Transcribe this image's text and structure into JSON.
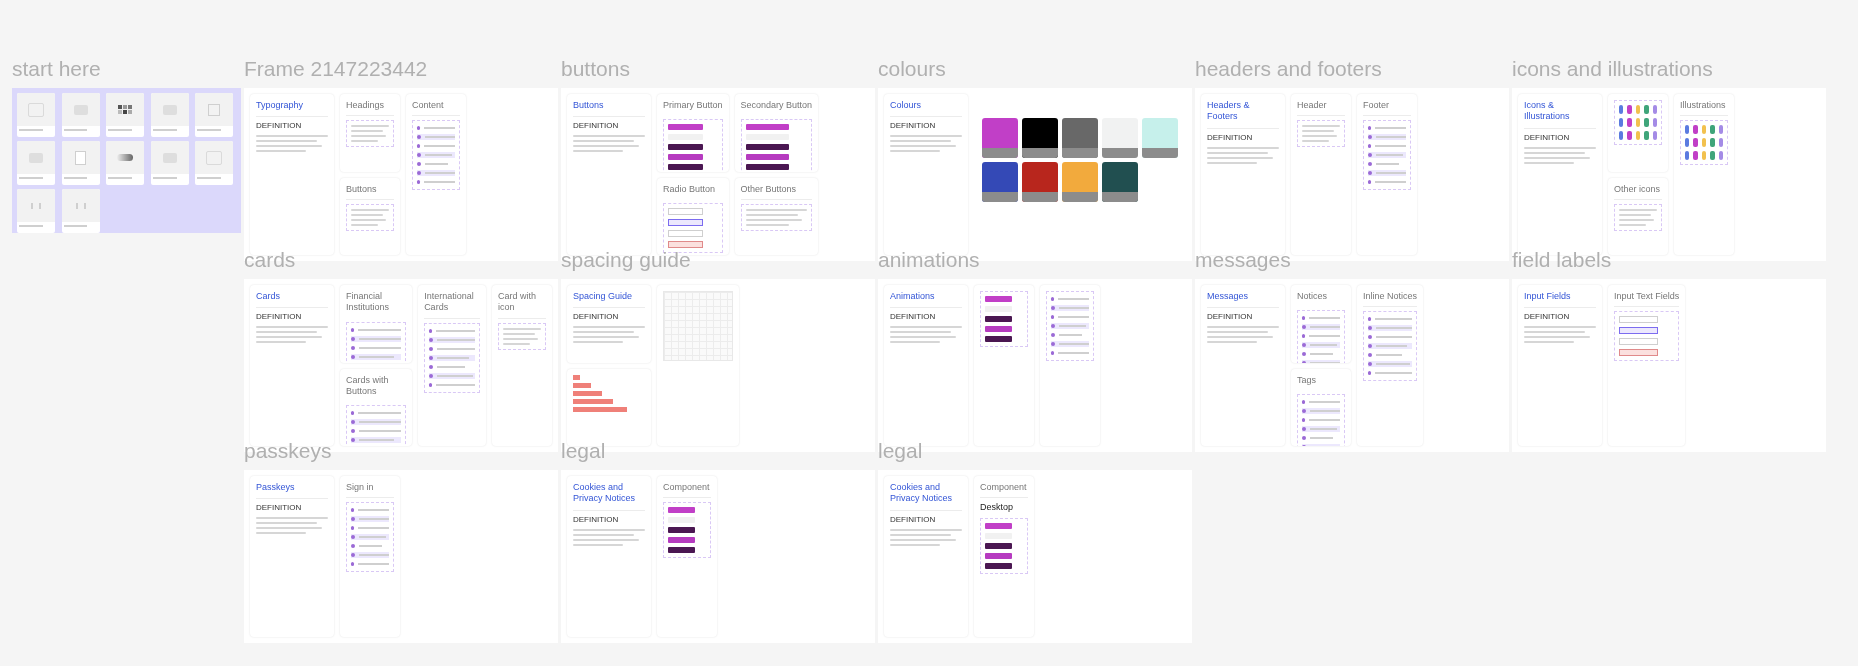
{
  "sections": [
    {
      "label": "start here",
      "kind": "thumbnails",
      "tiles": [
        {
          "kind": "type"
        },
        {
          "kind": "image"
        },
        {
          "kind": "swatch"
        },
        {
          "kind": "image"
        },
        {
          "kind": "frame"
        },
        {
          "kind": "image"
        },
        {
          "kind": "card"
        },
        {
          "kind": "motion"
        },
        {
          "kind": "image"
        },
        {
          "kind": "type"
        },
        {
          "kind": "code"
        },
        {
          "kind": "code"
        }
      ]
    },
    {
      "label": "Frame 2147223442",
      "kind": "frame",
      "columns": [
        [
          {
            "kind": "doc",
            "title": "Typography",
            "heading": "DEFINITION"
          }
        ],
        [
          {
            "kind": "lines",
            "title": "Headings"
          },
          {
            "kind": "lines",
            "title": "Buttons"
          }
        ],
        [
          {
            "kind": "list",
            "title": "Content"
          }
        ]
      ]
    },
    {
      "label": "buttons",
      "kind": "frame",
      "columns": [
        [
          {
            "kind": "doc",
            "title": "Buttons",
            "heading": "DEFINITION"
          }
        ],
        [
          {
            "kind": "buttons",
            "title": "Primary Button"
          },
          {
            "kind": "radio",
            "title": "Radio Button"
          }
        ],
        [
          {
            "kind": "buttons",
            "title": "Secondary Button"
          },
          {
            "kind": "lines",
            "title": "Other Buttons"
          }
        ]
      ]
    },
    {
      "label": "colours",
      "kind": "frame",
      "columns": [
        [
          {
            "kind": "doc",
            "title": "Colours",
            "heading": "DEFINITION"
          }
        ],
        [
          {
            "kind": "swatches",
            "colours": [
              {
                "color": "#c13fc7"
              },
              {
                "color": "#000000"
              },
              {
                "color": "#686868"
              },
              {
                "color": "#f1f2f2"
              },
              {
                "color": "#c6f0eb"
              },
              {
                "color": "#3449b6"
              },
              {
                "color": "#b8261d"
              },
              {
                "color": "#f2aa3d"
              },
              {
                "color": "#214f50"
              }
            ]
          }
        ]
      ]
    },
    {
      "label": "headers and footers",
      "kind": "frame",
      "columns": [
        [
          {
            "kind": "doc",
            "title": "Headers & Footers",
            "heading": "DEFINITION"
          }
        ],
        [
          {
            "kind": "lines",
            "title": "Header"
          }
        ],
        [
          {
            "kind": "list",
            "title": "Footer"
          }
        ]
      ]
    },
    {
      "label": "icons and illustrations",
      "kind": "frame",
      "columns": [
        [
          {
            "kind": "doc",
            "title": "Icons & Illustrations",
            "heading": "DEFINITION"
          }
        ],
        [
          {
            "kind": "icons"
          },
          {
            "kind": "lines",
            "title": "Other icons"
          }
        ],
        [
          {
            "kind": "icons",
            "title": "Illustrations"
          }
        ]
      ]
    },
    {
      "label": "cards",
      "kind": "frame",
      "columns": [
        [
          {
            "kind": "doc",
            "title": "Cards",
            "heading": "DEFINITION"
          }
        ],
        [
          {
            "kind": "list",
            "title": "Financial Institutions"
          },
          {
            "kind": "list",
            "title": "Cards with Buttons"
          }
        ],
        [
          {
            "kind": "list",
            "title": "International Cards"
          }
        ],
        [
          {
            "kind": "lines",
            "title": "Card with icon"
          }
        ]
      ]
    },
    {
      "label": "spacing guide",
      "kind": "frame",
      "columns": [
        [
          {
            "kind": "doc",
            "title": "Spacing Guide",
            "heading": "DEFINITION"
          },
          {
            "kind": "bars"
          }
        ],
        [
          {
            "kind": "grid"
          }
        ]
      ]
    },
    {
      "label": "animations",
      "kind": "frame",
      "columns": [
        [
          {
            "kind": "doc",
            "title": "Animations",
            "heading": "DEFINITION"
          }
        ],
        [
          {
            "kind": "buttons"
          }
        ],
        [
          {
            "kind": "list"
          }
        ]
      ]
    },
    {
      "label": "messages",
      "kind": "frame",
      "columns": [
        [
          {
            "kind": "doc",
            "title": "Messages",
            "heading": "DEFINITION"
          }
        ],
        [
          {
            "kind": "list",
            "title": "Notices"
          },
          {
            "kind": "list",
            "title": "Tags"
          }
        ],
        [
          {
            "kind": "list",
            "title": "Inline Notices"
          }
        ]
      ]
    },
    {
      "label": "field labels",
      "kind": "frame",
      "columns": [
        [
          {
            "kind": "doc",
            "title": "Input Fields",
            "heading": "DEFINITION"
          }
        ],
        [
          {
            "kind": "radio",
            "title": "Input Text Fields"
          }
        ]
      ]
    },
    {
      "label": "passkeys",
      "kind": "frame",
      "columns": [
        [
          {
            "kind": "doc",
            "title": "Passkeys",
            "heading": "DEFINITION"
          }
        ],
        [
          {
            "kind": "list",
            "title": "Sign in"
          }
        ]
      ]
    },
    {
      "label": "legal",
      "kind": "frame",
      "columns": [
        [
          {
            "kind": "doc",
            "title": "Cookies and Privacy Notices",
            "heading": "DEFINITION"
          }
        ],
        [
          {
            "kind": "buttons",
            "title": "Component"
          }
        ]
      ]
    },
    {
      "label": "legal",
      "kind": "frame",
      "columns": [
        [
          {
            "kind": "doc",
            "title": "Cookies and Privacy Notices",
            "heading": "DEFINITION"
          }
        ],
        [
          {
            "kind": "buttons",
            "title": "Component",
            "subtitle": "Desktop"
          }
        ]
      ]
    }
  ]
}
